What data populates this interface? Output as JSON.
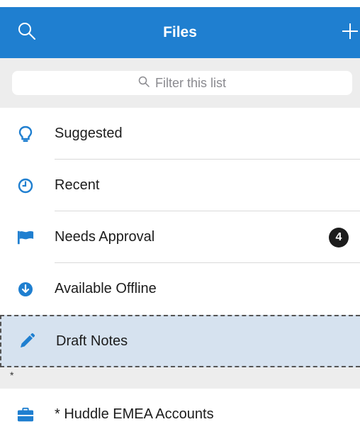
{
  "header": {
    "title": "Files",
    "search_icon": "search-icon",
    "add_icon": "plus-icon",
    "color": "#1f7fd0"
  },
  "filter": {
    "placeholder": "Filter this list"
  },
  "items": [
    {
      "label": "Suggested",
      "icon": "lightbulb-icon"
    },
    {
      "label": "Recent",
      "icon": "clock-icon"
    },
    {
      "label": "Needs Approval",
      "icon": "flag-icon",
      "badge": "4"
    },
    {
      "label": "Available Offline",
      "icon": "download-circle-icon"
    },
    {
      "label": "Draft Notes",
      "icon": "pencil-icon",
      "selected": true
    }
  ],
  "section": {
    "header": "*",
    "items": [
      {
        "label": "* Huddle EMEA Accounts",
        "icon": "briefcase-icon"
      }
    ]
  }
}
